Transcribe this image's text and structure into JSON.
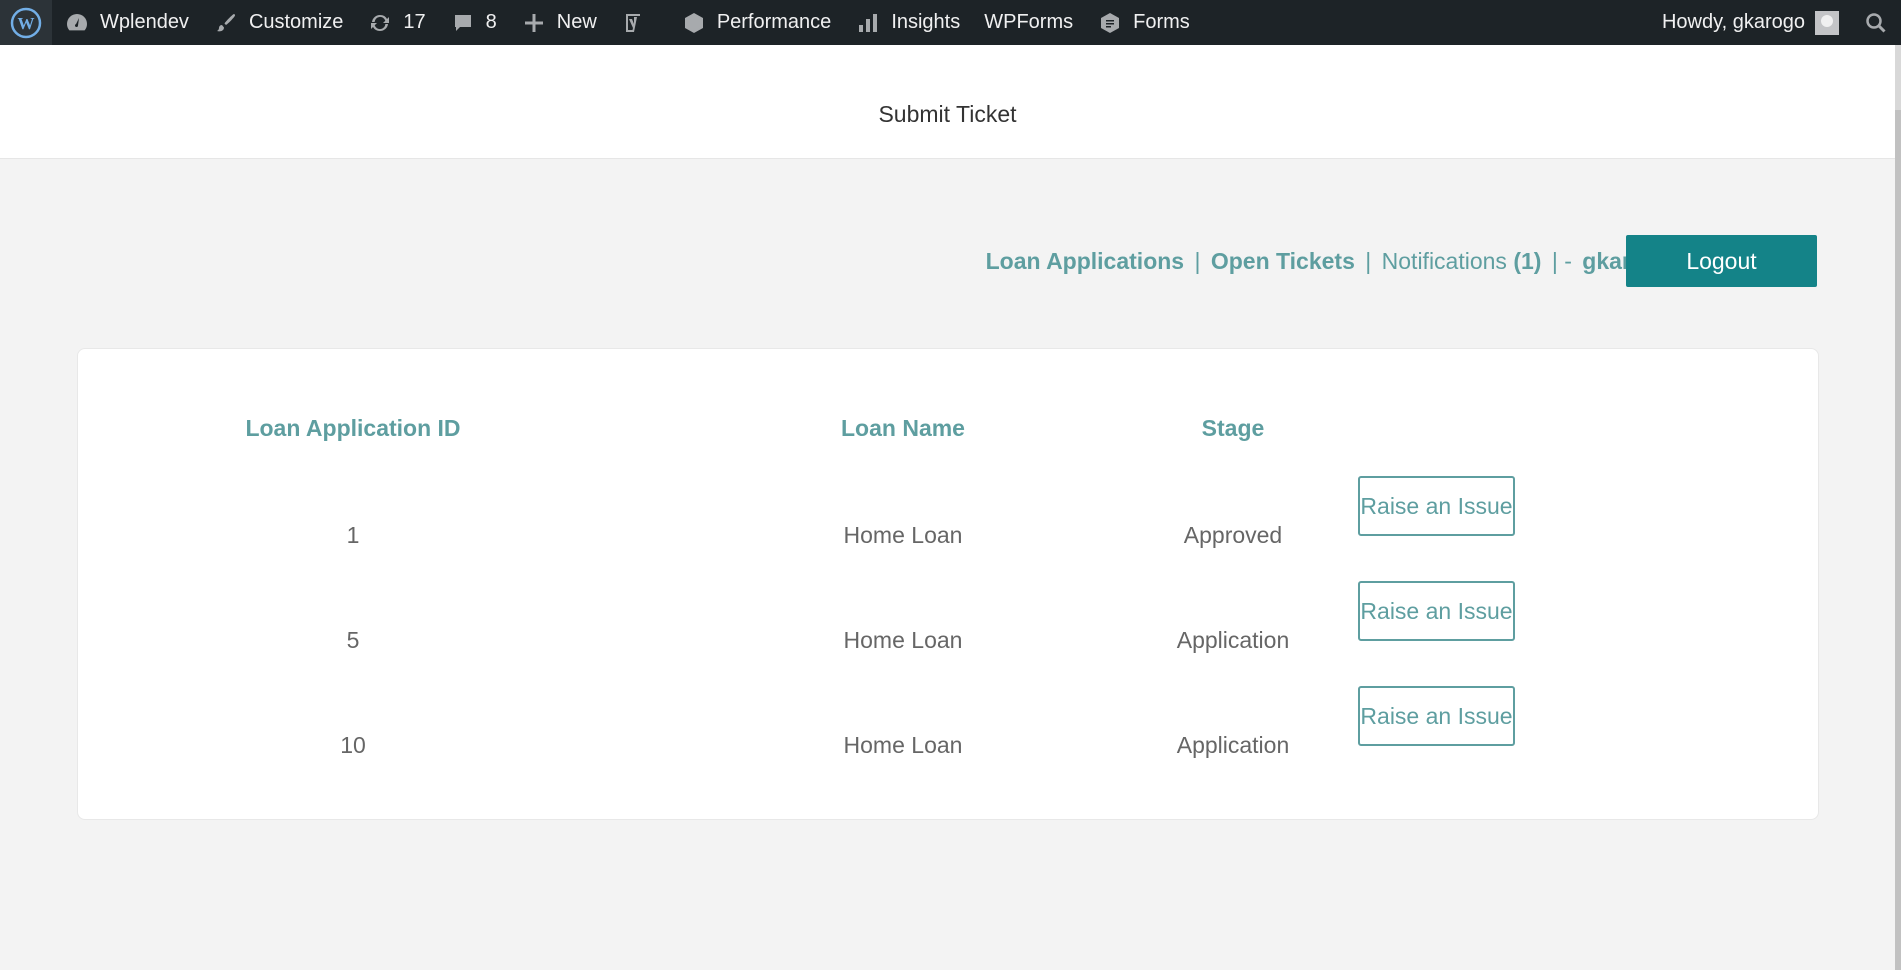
{
  "adminbar": {
    "site_name": "Wplendev",
    "customize": "Customize",
    "updates_count": "17",
    "comments_count": "8",
    "new_label": "New",
    "performance": "Performance",
    "insights": "Insights",
    "wpforms": "WPForms",
    "forms": "Forms",
    "howdy": "Howdy, gkarogo"
  },
  "header": {
    "title": "Submit Ticket"
  },
  "user_nav": {
    "loan_applications": "Loan Applications",
    "sep1": "|",
    "open_tickets": "Open Tickets",
    "sep2": "|",
    "notifications": "Notifications",
    "notifications_count": "(1)",
    "sep3": "| -",
    "username": "gkarogo",
    "logout": "Logout"
  },
  "table": {
    "headers": [
      "Loan Application ID",
      "Loan Name",
      "Stage"
    ],
    "rows": [
      {
        "id": "1",
        "name": "Home Loan",
        "stage": "Approved",
        "action": "Raise an Issue"
      },
      {
        "id": "5",
        "name": "Home Loan",
        "stage": "Application",
        "action": "Raise an Issue"
      },
      {
        "id": "10",
        "name": "Home Loan",
        "stage": "Application",
        "action": "Raise an Issue"
      }
    ]
  },
  "colors": {
    "accent": "#5e9ea0",
    "logout_bg": "#148388",
    "adminbar_bg": "#1d2327"
  }
}
